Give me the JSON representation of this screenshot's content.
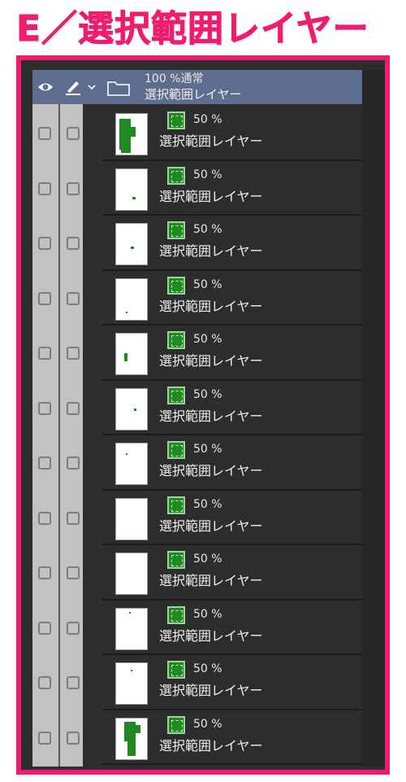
{
  "title": "E／選択範囲レイヤー",
  "panel": {
    "folder": {
      "mode": "100 %通常",
      "name": "選択範囲レイヤー",
      "icons": [
        "eye-icon",
        "pen-icon",
        "chevron-down-icon",
        "folder-icon"
      ]
    },
    "layers": [
      {
        "opacity": "50 %",
        "name": "選択範囲レイヤー"
      },
      {
        "opacity": "50 %",
        "name": "選択範囲レイヤー"
      },
      {
        "opacity": "50 %",
        "name": "選択範囲レイヤー"
      },
      {
        "opacity": "50 %",
        "name": "選択範囲レイヤー"
      },
      {
        "opacity": "50 %",
        "name": "選択範囲レイヤー"
      },
      {
        "opacity": "50 %",
        "name": "選択範囲レイヤー"
      },
      {
        "opacity": "50 %",
        "name": "選択範囲レイヤー"
      },
      {
        "opacity": "50 %",
        "name": "選択範囲レイヤー"
      },
      {
        "opacity": "50 %",
        "name": "選択範囲レイヤー"
      },
      {
        "opacity": "50 %",
        "name": "選択範囲レイヤー"
      },
      {
        "opacity": "50 %",
        "name": "選択範囲レイヤー"
      },
      {
        "opacity": "50 %",
        "name": "選択範囲レイヤー"
      }
    ]
  },
  "colors": {
    "accent": "#f01c6e",
    "selection_green": "#1f8a1f",
    "header_bg": "#5c6d8d"
  }
}
